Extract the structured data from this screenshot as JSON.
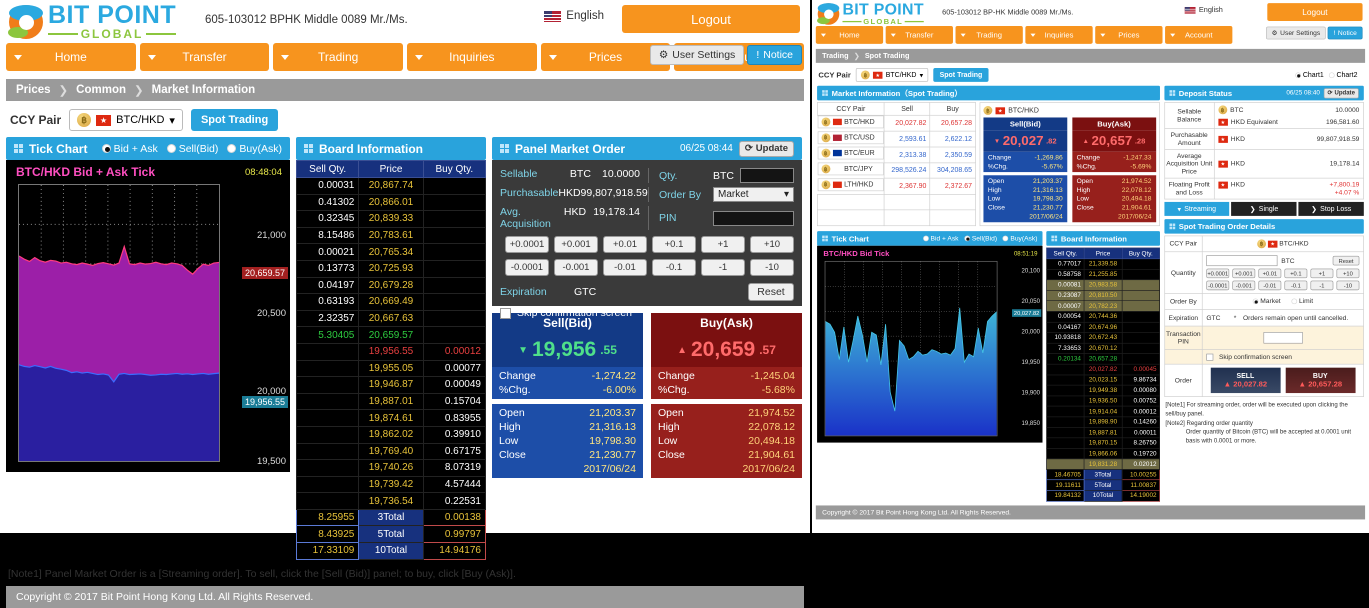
{
  "brand": {
    "bit": "BIT POINT",
    "global": "GLOBAL"
  },
  "header": {
    "account": "605-103012   BPHK Middle 0089 Mr./Ms.",
    "account_right": "605-103012   BP-HK Middle 0089 Mr./Ms.",
    "language": "English",
    "logout": "Logout",
    "user_settings": "User Settings",
    "notice": "Notice"
  },
  "nav": [
    {
      "label": "Home"
    },
    {
      "label": "Transfer"
    },
    {
      "label": "Trading"
    },
    {
      "label": "Inquiries"
    },
    {
      "label": "Prices"
    },
    {
      "label": "Account"
    }
  ],
  "left": {
    "breadcrumb": [
      "Prices",
      "Common",
      "Market Information"
    ],
    "ccy_label": "CCY Pair",
    "ccy_value": "BTC/HKD",
    "spot_button": "Spot Trading",
    "tick_panel": {
      "title": "Tick Chart",
      "options": [
        "Bid + Ask",
        "Sell(Bid)",
        "Buy(Ask)"
      ],
      "selected": "Bid + Ask",
      "chart_title": "BTC/HKD   Bid + Ask Tick",
      "time": "08:48:04"
    },
    "board": {
      "title": "Board Information",
      "columns": [
        "Sell Qty.",
        "Price",
        "Buy Qty."
      ],
      "sell_rows": [
        {
          "qty": "0.00031",
          "price": "20,867.74"
        },
        {
          "qty": "0.41302",
          "price": "20,866.01"
        },
        {
          "qty": "0.32345",
          "price": "20,839.33"
        },
        {
          "qty": "8.15486",
          "price": "20,783.61"
        },
        {
          "qty": "0.00021",
          "price": "20,765.34"
        },
        {
          "qty": "0.13773",
          "price": "20,725.93"
        },
        {
          "qty": "0.04197",
          "price": "20,679.28"
        },
        {
          "qty": "0.63193",
          "price": "20,669.49"
        },
        {
          "qty": "2.32357",
          "price": "20,667.63"
        },
        {
          "qty": "5.30405",
          "price": "20,659.57",
          "highlight": "green"
        }
      ],
      "buy_rows": [
        {
          "price": "19,956.55",
          "qty": "0.00012",
          "highlight": "red"
        },
        {
          "price": "19,955.05",
          "qty": "0.00077"
        },
        {
          "price": "19,946.87",
          "qty": "0.00049"
        },
        {
          "price": "19,887.01",
          "qty": "0.15704"
        },
        {
          "price": "19,874.61",
          "qty": "0.83955"
        },
        {
          "price": "19,862.02",
          "qty": "0.39910"
        },
        {
          "price": "19,769.40",
          "qty": "0.67175"
        },
        {
          "price": "19,740.26",
          "qty": "8.07319"
        },
        {
          "price": "19,739.42",
          "qty": "4.57444"
        },
        {
          "price": "19,736.54",
          "qty": "0.22531"
        }
      ],
      "totals": [
        {
          "sell": "8.25955",
          "label": "3Total",
          "buy": "0.00138"
        },
        {
          "sell": "8.43925",
          "label": "5Total",
          "buy": "0.99797"
        },
        {
          "sell": "17.33109",
          "label": "10Total",
          "buy": "14.94176"
        }
      ]
    },
    "order": {
      "title": "Panel Market Order",
      "update_time": "06/25 08:44",
      "update_label": "Update",
      "sellable_label": "Sellable",
      "sellable_ccy": "BTC",
      "sellable_value": "10.0000",
      "purchasable_label": "Purchasable",
      "purchasable_ccy": "HKD",
      "purchasable_value": "99,807,918.59",
      "avg_label": "Avg. Acquisition",
      "avg_ccy": "HKD",
      "avg_value": "19,178.14",
      "qty_label": "Qty.",
      "qty_unit": "BTC",
      "qty_value": "",
      "orderby_label": "Order By",
      "orderby_value": "Market",
      "pin_label": "PIN",
      "pin_value": "",
      "steps_plus": [
        "+0.0001",
        "+0.001",
        "+0.01",
        "+0.1",
        "+1",
        "+10"
      ],
      "steps_minus": [
        "-0.0001",
        "-0.001",
        "-0.01",
        "-0.1",
        "-1",
        "-10"
      ],
      "expiration_label": "Expiration",
      "expiration_value": "GTC",
      "reset_label": "Reset",
      "skip_label": "Skip confirmation screen"
    },
    "bid": {
      "title": "Sell(Bid)",
      "arrow": "▼",
      "price_int": "19,956",
      "price_dec": ".55",
      "rows": [
        {
          "k": "Change",
          "v": "-1,274.22"
        },
        {
          "k": "%Chg.",
          "v": "-6.00%"
        }
      ],
      "ohlc": [
        {
          "k": "Open",
          "v": "21,203.37"
        },
        {
          "k": "High",
          "v": "21,316.13"
        },
        {
          "k": "Low",
          "v": "19,798.30"
        },
        {
          "k": "Close",
          "v": "21,230.77"
        }
      ],
      "date": "2017/06/24"
    },
    "ask": {
      "title": "Buy(Ask)",
      "arrow": "▲",
      "price_int": "20,659",
      "price_dec": ".57",
      "rows": [
        {
          "k": "Change",
          "v": "-1,245.04"
        },
        {
          "k": "%Chg.",
          "v": "-5.68%"
        }
      ],
      "ohlc": [
        {
          "k": "Open",
          "v": "21,974.52"
        },
        {
          "k": "High",
          "v": "22,078.12"
        },
        {
          "k": "Low",
          "v": "20,494.18"
        },
        {
          "k": "Close",
          "v": "21,904.61"
        }
      ],
      "date": "2017/06/24"
    },
    "note": "[Note1]  Panel Market Order is a [Streaming order]. To sell, click the [Sell (Bid)] panel; to buy, click [Buy (Ask)].",
    "copyright": "Copyright © 2017 Bit Point Hong Kong Ltd. All Rights Reserved.",
    "chart_data": {
      "type": "area",
      "title": "BTC/HKD   Bid + Ask Tick",
      "ylabel": "",
      "xlabel": "",
      "ylim": [
        19400,
        21150
      ],
      "yticks": [
        "21,000",
        "20,500",
        "20,000",
        "19,500"
      ],
      "grid": true,
      "legend": "none",
      "series": [
        {
          "name": "Ask",
          "color": "#ff3b7f",
          "label": "20,659.57",
          "values": [
            20700,
            20680,
            20665,
            20690,
            20670,
            20660,
            20672,
            20668,
            20655,
            20660,
            20650,
            20645,
            20655,
            20648,
            20640,
            20652,
            20658,
            20650,
            20642,
            20655,
            20760,
            20650,
            20645,
            20655,
            20648,
            20652,
            20660,
            20650,
            20645,
            20655,
            20650,
            20640,
            20610,
            20585,
            20620,
            20648,
            20640,
            20655,
            20659
          ]
        },
        {
          "name": "Bid",
          "color": "#3b6cff",
          "label": "19,956.55",
          "values": [
            20010,
            20000,
            19995,
            20005,
            19998,
            19990,
            20000,
            19988,
            19982,
            19975,
            19960,
            19965,
            19958,
            19962,
            19955,
            19948,
            19952,
            19945,
            19902,
            19950,
            19955,
            19948,
            19950,
            19952,
            19948,
            19944,
            19946,
            19950,
            19948,
            19952,
            19955,
            19950,
            19953,
            19948,
            19952,
            19955,
            19950,
            19954,
            19957
          ]
        }
      ]
    }
  },
  "right": {
    "breadcrumb": [
      "Trading",
      "Spot Trading"
    ],
    "ccy_label": "CCY Pair",
    "ccy_value": "BTC/HKD",
    "spot_button": "Spot Trading",
    "chart_tabs": [
      "Chart1",
      "Chart2"
    ],
    "market_info": {
      "title": "Market Information（Spot Trading）",
      "columns": [
        "CCY Pair",
        "Sell",
        "Buy"
      ],
      "rows": [
        {
          "pair": "BTC/HKD",
          "sell": "20,027.82",
          "buy": "20,657.28",
          "flag": "hk",
          "up": false
        },
        {
          "pair": "BTC/USD",
          "sell": "2,593.61",
          "buy": "2,622.12",
          "flag": "us",
          "up": true
        },
        {
          "pair": "BTC/EUR",
          "sell": "2,313.38",
          "buy": "2,350.59",
          "flag": "eu",
          "up": true
        },
        {
          "pair": "BTC/JPY",
          "sell": "298,526.24",
          "buy": "304,208.65",
          "flag": "jp",
          "up": true
        },
        {
          "pair": "LTH/HKD",
          "sell": "2,367.90",
          "buy": "2,372.67",
          "flag": "hk",
          "up": false
        }
      ]
    },
    "quote": {
      "pair": "BTC/HKD",
      "bid": {
        "title": "Sell(Bid)",
        "arrow": "▼",
        "price_int": "20,027",
        "price_dec": ".82",
        "rows": [
          {
            "k": "Change",
            "v": "-1,269.86"
          },
          {
            "k": "%Chg.",
            "v": "-5.67%"
          }
        ],
        "ohlc": [
          {
            "k": "Open",
            "v": "21,203.37"
          },
          {
            "k": "High",
            "v": "21,316.13"
          },
          {
            "k": "Low",
            "v": "19,798.30"
          },
          {
            "k": "Close",
            "v": "21,230.77"
          }
        ],
        "date": "2017/06/24"
      },
      "ask": {
        "title": "Buy(Ask)",
        "arrow": "▲",
        "price_int": "20,657",
        "price_dec": ".28",
        "rows": [
          {
            "k": "Change",
            "v": "-1,247.33"
          },
          {
            "k": "%Chg.",
            "v": "-5.69%"
          }
        ],
        "ohlc": [
          {
            "k": "Open",
            "v": "21,974.52"
          },
          {
            "k": "High",
            "v": "22,078.12"
          },
          {
            "k": "Low",
            "v": "20,494.18"
          },
          {
            "k": "Close",
            "v": "21,904.61"
          }
        ],
        "date": "2017/06/24"
      }
    },
    "deposit": {
      "title": "Deposit Status",
      "update_time": "06/25 08:40",
      "update_label": "Update",
      "rows": [
        {
          "k": "Sellable Balance",
          "lines": [
            {
              "ccy": "BTC",
              "icon": "coin",
              "v": "10.0000"
            },
            {
              "ccy": "HKD Equivalent",
              "icon": "hk",
              "v": "196,581.60"
            }
          ]
        },
        {
          "k": "Purchasable Amount",
          "lines": [
            {
              "ccy": "HKD",
              "icon": "hk",
              "v": "99,807,918.59"
            }
          ]
        },
        {
          "k": "Average Acquisition Unit Price",
          "lines": [
            {
              "ccy": "HKD",
              "icon": "hk",
              "v": "19,178.14"
            }
          ]
        },
        {
          "k": "Floating Profit and Loss",
          "lines": [
            {
              "ccy": "HKD",
              "icon": "hk",
              "v": "+7,800.19",
              "v2": "+4.07 %",
              "red": true
            }
          ]
        }
      ]
    },
    "order_tabs": [
      {
        "label": "Streaming",
        "active": true
      },
      {
        "label": "Single",
        "active": false
      },
      {
        "label": "Stop Loss",
        "active": false
      }
    ],
    "order_details": {
      "title": "Spot Trading Order Details",
      "ccy_label": "CCY Pair",
      "ccy_value": "BTC/HKD",
      "qty_label": "Quantity",
      "qty_unit": "BTC",
      "qty_value": "",
      "reset_label": "Reset",
      "steps_plus": [
        "+0.0001",
        "+0.001",
        "+0.01",
        "+0.1",
        "+1",
        "+10"
      ],
      "steps_minus": [
        "-0.0001",
        "-0.001",
        "-0.01",
        "-0.1",
        "-1",
        "-10"
      ],
      "orderby_label": "Order By",
      "orderby_options": [
        "Market",
        "Limit"
      ],
      "orderby_selected": "Market",
      "expiration_label": "Expiration",
      "expiration_value": "GTC",
      "expiration_note": "*　Orders remain open until cancelled.",
      "pin_label": "Transaction PIN",
      "pin_value": "",
      "skip_label": "Skip confirmation screen",
      "order_label": "Order",
      "sell_button": {
        "label": "SELL",
        "price": "▲ 20,027.82"
      },
      "buy_button": {
        "label": "BUY",
        "price": "▲ 20,657.28"
      }
    },
    "tick_panel": {
      "title": "Tick Chart",
      "options": [
        "Bid + Ask",
        "Sell(Bid)",
        "Buy(Ask)"
      ],
      "selected": "Sell(Bid)",
      "chart_title": "BTC/HKD   Bid Tick",
      "time": "08:51:19"
    },
    "board": {
      "title": "Board Information",
      "columns": [
        "Sell Qty.",
        "Price",
        "Buy Qty."
      ],
      "sell_rows": [
        {
          "qty": "0.77017",
          "price": "21,339.58"
        },
        {
          "qty": "0.58758",
          "price": "21,255.85"
        },
        {
          "qty": "0.00081",
          "price": "20,983.58",
          "dim": true
        },
        {
          "qty": "0.23087",
          "price": "20,810.50",
          "dim": true
        },
        {
          "qty": "0.00007",
          "price": "20,782.23",
          "dim": true
        },
        {
          "qty": "0.00054",
          "price": "20,744.36"
        },
        {
          "qty": "0.04167",
          "price": "20,674.96"
        },
        {
          "qty": "10.93818",
          "price": "20,672.43"
        },
        {
          "qty": "7.33653",
          "price": "20,670.12"
        },
        {
          "qty": "0.20134",
          "price": "20,657.28",
          "highlight": "green"
        }
      ],
      "buy_rows": [
        {
          "price": "20,027.82",
          "qty": "0.00045",
          "highlight": "red"
        },
        {
          "price": "20,023.15",
          "qty": "9.86734"
        },
        {
          "price": "19,949.38",
          "qty": "0.00080"
        },
        {
          "price": "19,936.50",
          "qty": "0.00752"
        },
        {
          "price": "19,914.04",
          "qty": "0.00012"
        },
        {
          "price": "19,898.90",
          "qty": "0.14260"
        },
        {
          "price": "19,887.81",
          "qty": "0.00011"
        },
        {
          "price": "19,870.15",
          "qty": "8.26750"
        },
        {
          "price": "19,866.06",
          "qty": "0.19720"
        },
        {
          "price": "19,831.28",
          "qty": "0.02012",
          "dim": true
        }
      ],
      "totals": [
        {
          "sell": "18.46705",
          "label": "3Total",
          "buy": "10.00255"
        },
        {
          "sell": "19.11611",
          "label": "5Total",
          "buy": "11.00837"
        },
        {
          "sell": "19.84132",
          "label": "10Total",
          "buy": "14.19002"
        }
      ]
    },
    "notes": [
      "[Note1]  For streaming order, order will be executed upon clicking the sell/buy panel.",
      "[Note2]  Regarding order quantity",
      "Order quantity of Bitcoin (BTC) will be accepted at 0.0001 unit basis with 0.0001 or more."
    ],
    "copyright": "Copyright © 2017 Bit Point Hong Kong Ltd. All Rights Reserved.",
    "chart_data": {
      "type": "area",
      "title": "BTC/HKD   Bid Tick",
      "ylim": [
        19800,
        20120
      ],
      "yticks": [
        "20,100",
        "20,050",
        "20,000",
        "19,950",
        "19,900",
        "19,850"
      ],
      "grid": true,
      "legend": "none",
      "series": [
        {
          "name": "Bid",
          "color": "#46c8e8",
          "label": "20,027.82",
          "values": [
            20010,
            20005,
            19990,
            19940,
            20000,
            19935,
            19975,
            20020,
            19985,
            19935,
            19990,
            19985,
            19930,
            20005,
            19880,
            19845,
            19975,
            19965,
            19940,
            19945,
            19955,
            19948,
            19950,
            19958,
            19955,
            19950,
            19952,
            19948,
            19960,
            20035,
            19935,
            19950,
            19945,
            19998,
            19952,
            20010,
            20020,
            20028
          ]
        }
      ]
    }
  }
}
